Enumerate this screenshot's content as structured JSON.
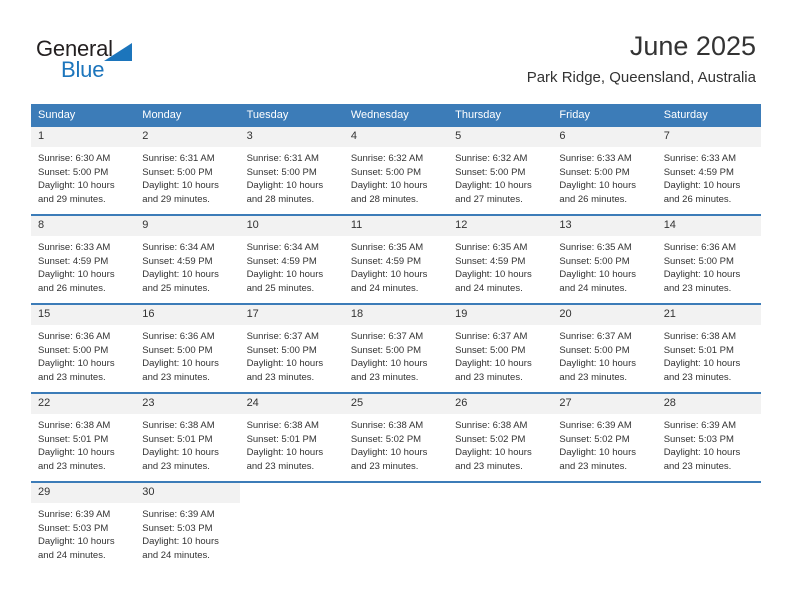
{
  "brand": {
    "name_top": "General",
    "name_bottom": "Blue",
    "accent_color": "#1c75bc"
  },
  "header": {
    "month_title": "June 2025",
    "location": "Park Ridge, Queensland, Australia"
  },
  "theme": {
    "header_bar_color": "#3c7cb8",
    "daynum_band_color": "#f2f2f2",
    "text_color": "#333333"
  },
  "calendar": {
    "weekday_headers": [
      "Sunday",
      "Monday",
      "Tuesday",
      "Wednesday",
      "Thursday",
      "Friday",
      "Saturday"
    ],
    "weeks": [
      [
        {
          "day": "1",
          "sunrise": "Sunrise: 6:30 AM",
          "sunset": "Sunset: 5:00 PM",
          "daylight": "Daylight: 10 hours and 29 minutes."
        },
        {
          "day": "2",
          "sunrise": "Sunrise: 6:31 AM",
          "sunset": "Sunset: 5:00 PM",
          "daylight": "Daylight: 10 hours and 29 minutes."
        },
        {
          "day": "3",
          "sunrise": "Sunrise: 6:31 AM",
          "sunset": "Sunset: 5:00 PM",
          "daylight": "Daylight: 10 hours and 28 minutes."
        },
        {
          "day": "4",
          "sunrise": "Sunrise: 6:32 AM",
          "sunset": "Sunset: 5:00 PM",
          "daylight": "Daylight: 10 hours and 28 minutes."
        },
        {
          "day": "5",
          "sunrise": "Sunrise: 6:32 AM",
          "sunset": "Sunset: 5:00 PM",
          "daylight": "Daylight: 10 hours and 27 minutes."
        },
        {
          "day": "6",
          "sunrise": "Sunrise: 6:33 AM",
          "sunset": "Sunset: 5:00 PM",
          "daylight": "Daylight: 10 hours and 26 minutes."
        },
        {
          "day": "7",
          "sunrise": "Sunrise: 6:33 AM",
          "sunset": "Sunset: 4:59 PM",
          "daylight": "Daylight: 10 hours and 26 minutes."
        }
      ],
      [
        {
          "day": "8",
          "sunrise": "Sunrise: 6:33 AM",
          "sunset": "Sunset: 4:59 PM",
          "daylight": "Daylight: 10 hours and 26 minutes."
        },
        {
          "day": "9",
          "sunrise": "Sunrise: 6:34 AM",
          "sunset": "Sunset: 4:59 PM",
          "daylight": "Daylight: 10 hours and 25 minutes."
        },
        {
          "day": "10",
          "sunrise": "Sunrise: 6:34 AM",
          "sunset": "Sunset: 4:59 PM",
          "daylight": "Daylight: 10 hours and 25 minutes."
        },
        {
          "day": "11",
          "sunrise": "Sunrise: 6:35 AM",
          "sunset": "Sunset: 4:59 PM",
          "daylight": "Daylight: 10 hours and 24 minutes."
        },
        {
          "day": "12",
          "sunrise": "Sunrise: 6:35 AM",
          "sunset": "Sunset: 4:59 PM",
          "daylight": "Daylight: 10 hours and 24 minutes."
        },
        {
          "day": "13",
          "sunrise": "Sunrise: 6:35 AM",
          "sunset": "Sunset: 5:00 PM",
          "daylight": "Daylight: 10 hours and 24 minutes."
        },
        {
          "day": "14",
          "sunrise": "Sunrise: 6:36 AM",
          "sunset": "Sunset: 5:00 PM",
          "daylight": "Daylight: 10 hours and 23 minutes."
        }
      ],
      [
        {
          "day": "15",
          "sunrise": "Sunrise: 6:36 AM",
          "sunset": "Sunset: 5:00 PM",
          "daylight": "Daylight: 10 hours and 23 minutes."
        },
        {
          "day": "16",
          "sunrise": "Sunrise: 6:36 AM",
          "sunset": "Sunset: 5:00 PM",
          "daylight": "Daylight: 10 hours and 23 minutes."
        },
        {
          "day": "17",
          "sunrise": "Sunrise: 6:37 AM",
          "sunset": "Sunset: 5:00 PM",
          "daylight": "Daylight: 10 hours and 23 minutes."
        },
        {
          "day": "18",
          "sunrise": "Sunrise: 6:37 AM",
          "sunset": "Sunset: 5:00 PM",
          "daylight": "Daylight: 10 hours and 23 minutes."
        },
        {
          "day": "19",
          "sunrise": "Sunrise: 6:37 AM",
          "sunset": "Sunset: 5:00 PM",
          "daylight": "Daylight: 10 hours and 23 minutes."
        },
        {
          "day": "20",
          "sunrise": "Sunrise: 6:37 AM",
          "sunset": "Sunset: 5:00 PM",
          "daylight": "Daylight: 10 hours and 23 minutes."
        },
        {
          "day": "21",
          "sunrise": "Sunrise: 6:38 AM",
          "sunset": "Sunset: 5:01 PM",
          "daylight": "Daylight: 10 hours and 23 minutes."
        }
      ],
      [
        {
          "day": "22",
          "sunrise": "Sunrise: 6:38 AM",
          "sunset": "Sunset: 5:01 PM",
          "daylight": "Daylight: 10 hours and 23 minutes."
        },
        {
          "day": "23",
          "sunrise": "Sunrise: 6:38 AM",
          "sunset": "Sunset: 5:01 PM",
          "daylight": "Daylight: 10 hours and 23 minutes."
        },
        {
          "day": "24",
          "sunrise": "Sunrise: 6:38 AM",
          "sunset": "Sunset: 5:01 PM",
          "daylight": "Daylight: 10 hours and 23 minutes."
        },
        {
          "day": "25",
          "sunrise": "Sunrise: 6:38 AM",
          "sunset": "Sunset: 5:02 PM",
          "daylight": "Daylight: 10 hours and 23 minutes."
        },
        {
          "day": "26",
          "sunrise": "Sunrise: 6:38 AM",
          "sunset": "Sunset: 5:02 PM",
          "daylight": "Daylight: 10 hours and 23 minutes."
        },
        {
          "day": "27",
          "sunrise": "Sunrise: 6:39 AM",
          "sunset": "Sunset: 5:02 PM",
          "daylight": "Daylight: 10 hours and 23 minutes."
        },
        {
          "day": "28",
          "sunrise": "Sunrise: 6:39 AM",
          "sunset": "Sunset: 5:03 PM",
          "daylight": "Daylight: 10 hours and 23 minutes."
        }
      ],
      [
        {
          "day": "29",
          "sunrise": "Sunrise: 6:39 AM",
          "sunset": "Sunset: 5:03 PM",
          "daylight": "Daylight: 10 hours and 24 minutes."
        },
        {
          "day": "30",
          "sunrise": "Sunrise: 6:39 AM",
          "sunset": "Sunset: 5:03 PM",
          "daylight": "Daylight: 10 hours and 24 minutes."
        },
        {
          "day": "",
          "sunrise": "",
          "sunset": "",
          "daylight": ""
        },
        {
          "day": "",
          "sunrise": "",
          "sunset": "",
          "daylight": ""
        },
        {
          "day": "",
          "sunrise": "",
          "sunset": "",
          "daylight": ""
        },
        {
          "day": "",
          "sunrise": "",
          "sunset": "",
          "daylight": ""
        },
        {
          "day": "",
          "sunrise": "",
          "sunset": "",
          "daylight": ""
        }
      ]
    ]
  }
}
